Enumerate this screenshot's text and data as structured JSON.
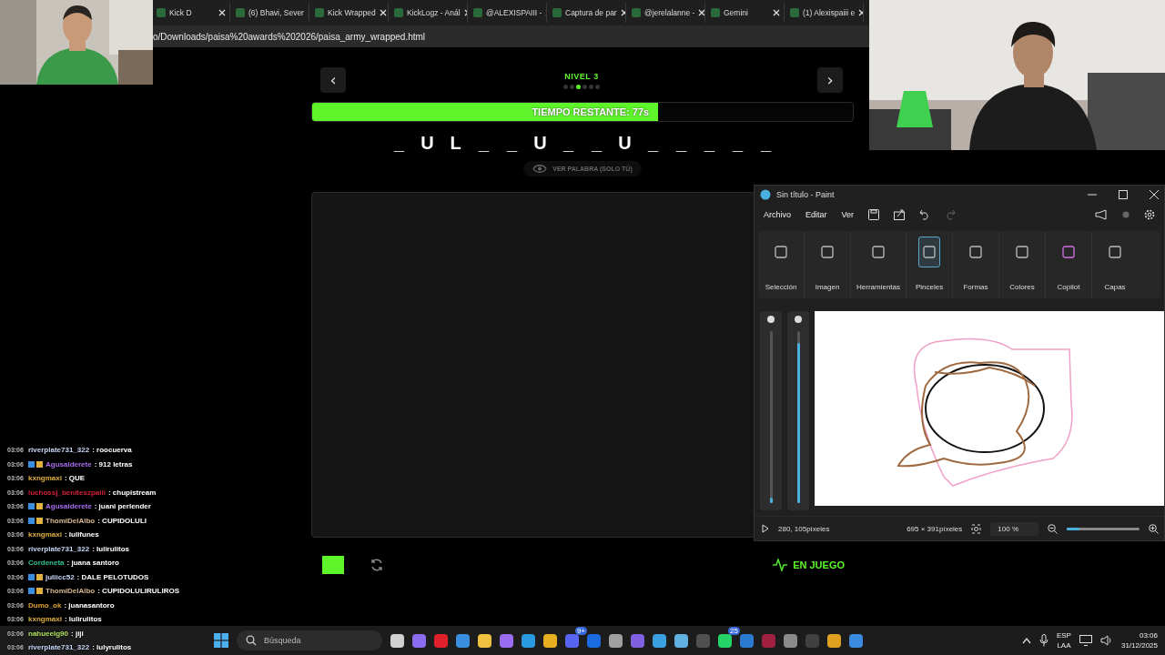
{
  "browser": {
    "tabs": [
      {
        "label": "Kick D",
        "selected": false
      },
      {
        "label": "(6) Bhavi, Sever",
        "selected": false
      },
      {
        "label": "Kick Wrapped",
        "selected": false
      },
      {
        "label": "KickLogz - Anál",
        "selected": false
      },
      {
        "label": "@ALEXISPAIII -",
        "selected": false
      },
      {
        "label": "Captura de par",
        "selected": false
      },
      {
        "label": "@jerelalanne -",
        "selected": false
      },
      {
        "label": "Gemini",
        "selected": false
      },
      {
        "label": "(1) Alexispaiii e",
        "selected": false
      }
    ],
    "address": "o/Downloads/paisa%20awards%202026/paisa_army_wrapped.html"
  },
  "game": {
    "prev": "‹",
    "next": "›",
    "level": "NIVEL 3",
    "dots": [
      {
        "selected": false
      },
      {
        "selected": false
      },
      {
        "selected": true
      },
      {
        "selected": false
      },
      {
        "selected": false
      },
      {
        "selected": false
      }
    ],
    "timer": {
      "label": "TIEMPO RESTANTE: 77s",
      "level": 0.64
    },
    "word": [
      "_",
      "U",
      "L",
      "_",
      "_",
      "U",
      "_",
      "_",
      "U",
      "_",
      "_",
      "_",
      "_",
      "_"
    ],
    "reveal_button": "VER PALABRA (SOLO TÚ)",
    "status": "EN JUEGO"
  },
  "paint": {
    "title": "Sin título - Paint",
    "menu": [
      "Archivo",
      "Editar",
      "Ver"
    ],
    "tools": [
      {
        "label": "Selección",
        "selected": false
      },
      {
        "label": "Imagen",
        "selected": false
      },
      {
        "label": "Herramientas",
        "selected": false
      },
      {
        "label": "Pinceles",
        "selected": true
      },
      {
        "label": "Formas",
        "selected": false
      },
      {
        "label": "Colores",
        "selected": false
      },
      {
        "label": "Copilot",
        "selected": false
      },
      {
        "label": "Capas",
        "selected": false
      }
    ],
    "brush_sliders": [
      {
        "level": 0.03
      },
      {
        "level": 0.93
      }
    ],
    "status": {
      "cursor": "280, 105píxeles",
      "size": "695 × 391píxeles",
      "zoom": "100 %"
    },
    "zoom_slider": {
      "level": 0.18
    }
  },
  "chat": [
    {
      "time": "03:06",
      "user": "riverplate731_322",
      "color": "#c8d8f8",
      "text": ": roocuerva",
      "badge": false
    },
    {
      "time": "03:06",
      "user": "Agusalderete",
      "color": "#a86cf0",
      "text": ": 912 letras",
      "badge": true
    },
    {
      "time": "03:06",
      "user": "kxngmaxi",
      "color": "#e0b040",
      "text": ": QUE",
      "badge": false
    },
    {
      "time": "03:06",
      "user": "luchossj_beniteszpaiii",
      "color": "#d02038",
      "text": ": chupistream",
      "badge": false
    },
    {
      "time": "03:06",
      "user": "Agusalderete",
      "color": "#a86cf0",
      "text": ": juani perlender",
      "badge": true
    },
    {
      "time": "03:06",
      "user": "ThomiDelAlbo",
      "color": "#d8b890",
      "text": ": CUPIDOLULI",
      "badge": true
    },
    {
      "time": "03:06",
      "user": "kxngmaxi",
      "color": "#e0b040",
      "text": ": lulifunes",
      "badge": false
    },
    {
      "time": "03:06",
      "user": "riverplate731_322",
      "color": "#c8d8f8",
      "text": ": lulirulitos",
      "badge": false
    },
    {
      "time": "03:06",
      "user": "Cordeneta",
      "color": "#30c090",
      "text": ": juana santoro",
      "badge": false
    },
    {
      "time": "03:06",
      "user": "juliicc52",
      "color": "#c8d8f8",
      "text": ": DALE PELOTUDOS",
      "badge": true
    },
    {
      "time": "03:06",
      "user": "ThomiDelAlbo",
      "color": "#d8b890",
      "text": ": CUPIDOLULIRULIROS",
      "badge": true
    },
    {
      "time": "03:06",
      "user": "Dumo_ok",
      "color": "#e0a030",
      "text": ": juanasantoro",
      "badge": false
    },
    {
      "time": "03:06",
      "user": "kxngmaxi",
      "color": "#e0b040",
      "text": ": lulirulitos",
      "badge": false
    },
    {
      "time": "03:06",
      "user": "nahueelg90",
      "color": "#b0e060",
      "text": ": jiji",
      "badge": false
    },
    {
      "time": "03:06",
      "user": "riverplate731_322",
      "color": "#c8d8f8",
      "text": ": lulyrulitos",
      "badge": false
    }
  ],
  "taskbar": {
    "search": "Búsqueda",
    "apps": [
      {
        "color": "#d0d0d0"
      },
      {
        "color": "#8a6cf0"
      },
      {
        "color": "#e0202a"
      },
      {
        "color": "#3a8ee0"
      },
      {
        "color": "#f0c040"
      },
      {
        "color": "#9a6cf0"
      },
      {
        "color": "#2a9ae0"
      },
      {
        "color": "#e8b020"
      },
      {
        "color": "#5865f2",
        "badge": "9+"
      },
      {
        "color": "#1a6ae0"
      },
      {
        "color": "#a0a0a0"
      },
      {
        "color": "#8060e0"
      },
      {
        "color": "#3aa0e0"
      },
      {
        "color": "#60b0e0"
      },
      {
        "color": "#505050"
      },
      {
        "color": "#25d366",
        "badge": "25"
      },
      {
        "color": "#2a7ad0"
      },
      {
        "color": "#a02040"
      },
      {
        "color": "#8a8a8a"
      },
      {
        "color": "#404040"
      },
      {
        "color": "#e0a020"
      },
      {
        "color": "#3a8ae0"
      }
    ],
    "tray": {
      "lang": "ESP",
      "region": "LAA",
      "time": "03:06",
      "date": "31/12/2025"
    }
  }
}
